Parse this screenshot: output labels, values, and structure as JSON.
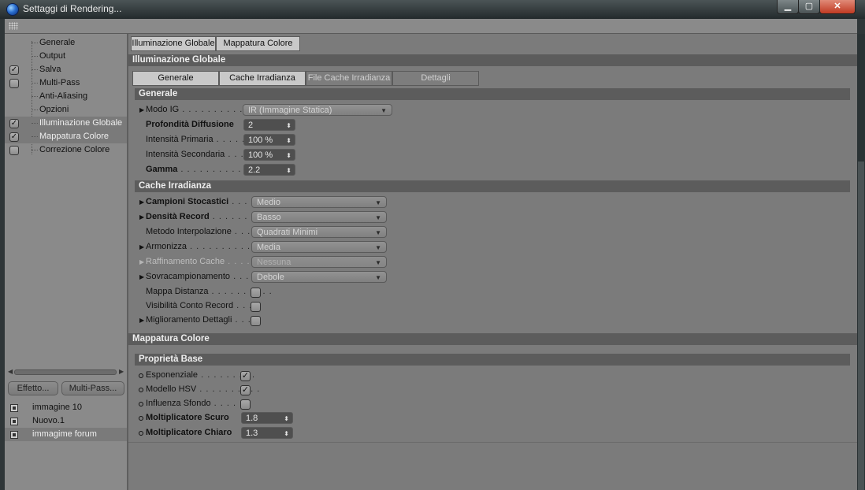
{
  "window": {
    "title": "Settaggi di Rendering..."
  },
  "window_controls": {
    "minimize": "▁",
    "maximize": "▢",
    "close": "✕"
  },
  "sidebar": {
    "items": [
      {
        "label": "Generale",
        "checked": null
      },
      {
        "label": "Output",
        "checked": null
      },
      {
        "label": "Salva",
        "checked": true
      },
      {
        "label": "Multi-Pass",
        "checked": false
      },
      {
        "label": "Anti-Aliasing",
        "checked": null
      },
      {
        "label": "Opzioni",
        "checked": null
      },
      {
        "label": "Illuminazione Globale",
        "checked": true,
        "selected": true
      },
      {
        "label": "Mappatura Colore",
        "checked": true,
        "selected": true
      },
      {
        "label": "Correzione Colore",
        "checked": false
      }
    ],
    "buttons": {
      "effect": "Effetto...",
      "multipass": "Multi-Pass..."
    },
    "scenes": [
      {
        "label": "immagine 10"
      },
      {
        "label": "Nuovo.1"
      },
      {
        "label": "immagime forum",
        "selected": true
      }
    ]
  },
  "top_tabs": [
    "Illuminazione Globale",
    "Mappatura Colore"
  ],
  "gi": {
    "header": "Illuminazione Globale",
    "subtabs": [
      "Generale",
      "Cache Irradianza",
      "File Cache Irradianza",
      "Dettagli"
    ],
    "generale": {
      "header": "Generale",
      "modo_ig": {
        "label": "Modo IG",
        "dots": " . . . . . . . . . . . .",
        "value": "IR (Immagine Statica)"
      },
      "profondita": {
        "label": "Profondità Diffusione",
        "value": "2"
      },
      "int_primaria": {
        "label": "Intensità Primaria",
        "dots": " . . . . . .",
        "value": "100 %"
      },
      "int_secondaria": {
        "label": "Intensità Secondaria",
        "dots": " . . .",
        "value": "100 %"
      },
      "gamma": {
        "label": "Gamma",
        "dots": " . . . . . . . . . . . . .",
        "value": "2.2"
      }
    },
    "cache": {
      "header": "Cache Irradianza",
      "campioni": {
        "label": "Campioni Stocastici",
        "dots": " . . .",
        "value": "Medio"
      },
      "densita": {
        "label": "Densità Record",
        "dots": " . . . . . .",
        "value": "Basso"
      },
      "metodo": {
        "label": "Metodo Interpolazione",
        "dots": " . . . .",
        "value": "Quadrati Minimi"
      },
      "armonizza": {
        "label": "Armonizza",
        "dots": " . . . . . . . . . . . . .",
        "value": "Media"
      },
      "raffinamento": {
        "label": "Raffinamento Cache",
        "dots": " . . . . .",
        "value": "Nessuna"
      },
      "sovra": {
        "label": "Sovracampionamento",
        "dots": " . . .",
        "value": "Debole"
      },
      "mappa": {
        "label": "Mappa Distanza",
        "dots": " . . . . . . . . . .",
        "checked": false
      },
      "visibilita": {
        "label": "Visibilità Conto Record",
        "dots": " . . . .",
        "checked": false
      },
      "miglioramento": {
        "label": "Miglioramento Dettagli",
        "dots": " . . . .",
        "checked": false
      }
    }
  },
  "cm": {
    "header": "Mappatura Colore",
    "proprieta": {
      "header": "Proprietà Base",
      "esponenziale": {
        "label": "Esponenziale",
        "dots": " . . . . . . . . .",
        "checked": true
      },
      "hsv": {
        "label": "Modello HSV",
        "dots": " . . . . . . . . . .",
        "checked": true
      },
      "influenza": {
        "label": "Influenza Sfondo",
        "dots": " . . . . . .",
        "checked": false
      },
      "scuro": {
        "label": "Moltiplicatore Scuro",
        "value": "1.8"
      },
      "chiaro": {
        "label": "Moltiplicatore Chiaro",
        "value": "1.3"
      }
    }
  },
  "glyphs": {
    "check": "✓",
    "arrow_right": "▶",
    "chevron": "▼",
    "updown": "⬍",
    "left": "◀",
    "right": "▶"
  }
}
